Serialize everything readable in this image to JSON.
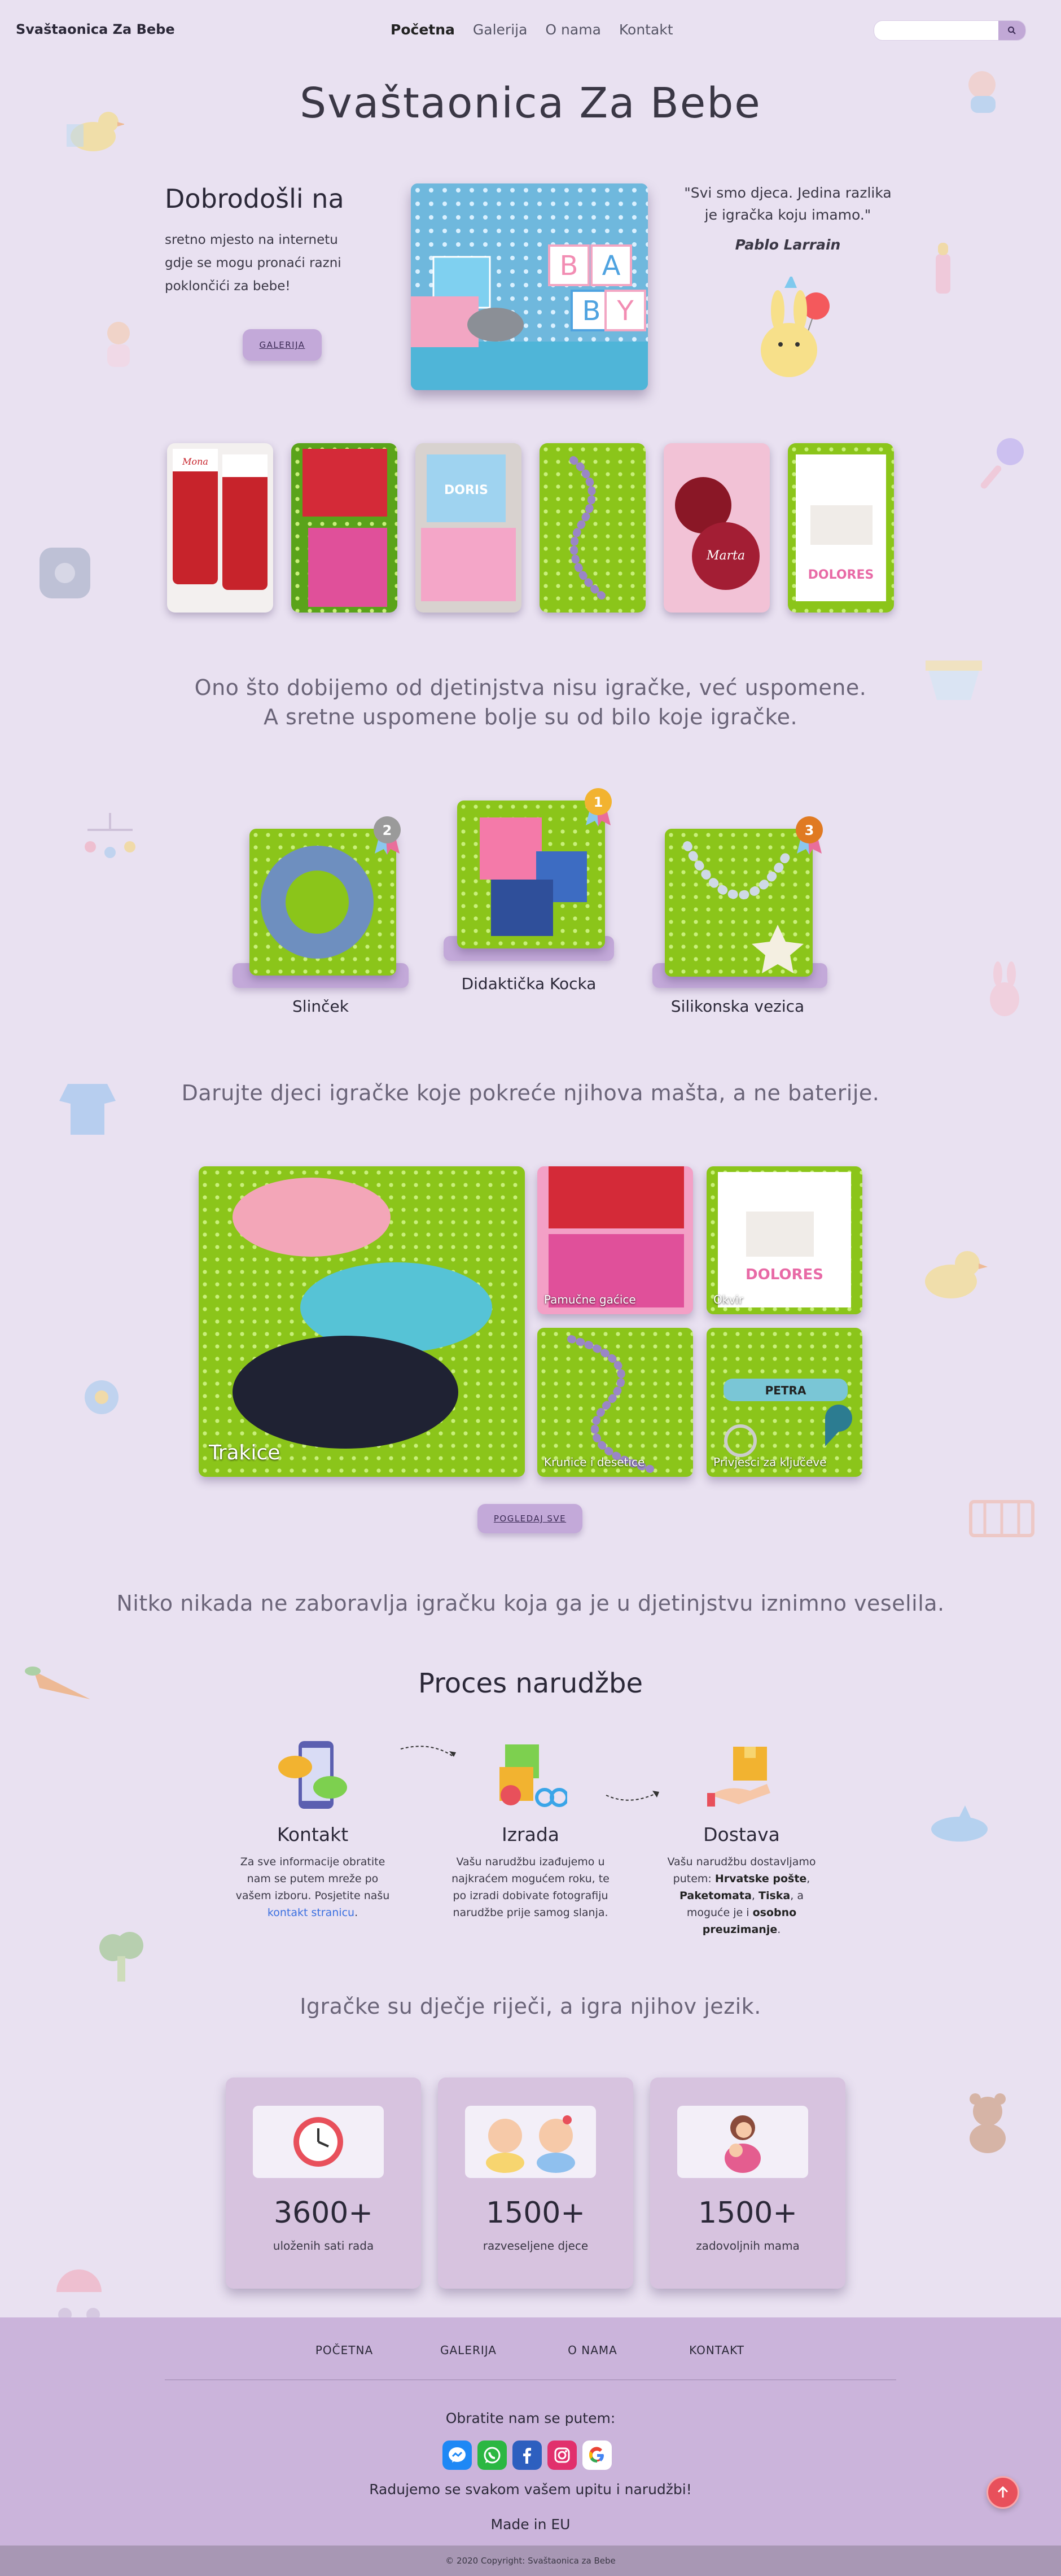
{
  "nav": {
    "brand": "Svaštaonica Za Bebe",
    "items": [
      "Početna",
      "Galerija",
      "O nama",
      "Kontakt"
    ],
    "search_placeholder": ""
  },
  "hero": {
    "title": "Svaštaonica Za Bebe",
    "welcome_title": "Dobrodošli na",
    "welcome_text": "sretno mjesto na internetu gdje se mogu pronaći razni poklončići za bebe!",
    "gallery_button": "GALERIJA",
    "quote": "\"Svi smo djeca. Jedina razlika je igračka koju imamo.\"",
    "quote_author": "Pablo Larrain",
    "hero_blocks": [
      "B",
      "A",
      "B",
      "Y"
    ]
  },
  "strip": [
    {
      "name": "Čarapice",
      "text": "Mona"
    },
    {
      "name": "Pindjame",
      "text": ""
    },
    {
      "name": "Kocke",
      "text": "DORIS"
    },
    {
      "name": "Krunica",
      "text": ""
    },
    {
      "name": "Kuglice",
      "text": "Marta"
    },
    {
      "name": "Okvir",
      "text": "DOLORES"
    }
  ],
  "taglines": {
    "t1": "Ono što dobijemo od djetinjstva nisu igračke, već uspomene. A sretne uspomene bolje su od bilo koje igračke.",
    "t2": "Darujte djeci igračke koje pokreće njihova mašta, a ne baterije.",
    "t3": "Nitko nikada ne zaboravlja igračku koja ga je u djetinjstvu iznimno veselila.",
    "t4": "Igračke su dječje riječi, a igra njihov jezik."
  },
  "products": [
    {
      "name": "Slinček",
      "rank": "2",
      "medal_color": "#9a9a9a"
    },
    {
      "name": "Didaktička Kocka",
      "rank": "1",
      "medal_color": "#f2b330"
    },
    {
      "name": "Silikonska vezica",
      "rank": "3",
      "medal_color": "#e07a22"
    }
  ],
  "mosaic": {
    "big": "Trakice",
    "tiles": [
      "Pamučne gaćice",
      "Okvir",
      "Krunice i desetice",
      "Privjesci za ključeve"
    ],
    "button": "POGLEDAJ SVE",
    "tag_name": "PETRA"
  },
  "process": {
    "title": "Proces narudžbe",
    "steps": [
      {
        "title": "Kontakt",
        "text_before": "Za sve informacije obratite nam se putem mreže po vašem izboru. Posjetite našu ",
        "link": "kontakt stranicu",
        "text_after": "."
      },
      {
        "title": "Izrada",
        "text": "Vašu narudžbu izađujemo u najkraćem mogućem roku, te po izradi dobivate fotografiju narudžbe prije samog slanja."
      },
      {
        "title": "Dostava",
        "text1": "Vašu narudžbu dostavljamo putem: ",
        "b1": "Hrvatske pošte",
        "text2": ", ",
        "b2": "Paketomata",
        "text3": ", ",
        "b3": "Tiska",
        "text4": ", a moguće je i ",
        "b4": "osobno preuzimanje",
        "text5": "."
      }
    ]
  },
  "stats": [
    {
      "value": "3600+",
      "label": "uloženih sati rada",
      "icon": "clock-icon"
    },
    {
      "value": "1500+",
      "label": "razveseljene djece",
      "icon": "babies-icon"
    },
    {
      "value": "1500+",
      "label": "zadovoljnih mama",
      "icon": "mother-icon"
    }
  ],
  "footer": {
    "menu": [
      "POČETNA",
      "GALERIJA",
      "O NAMA",
      "KONTAKT"
    ],
    "contact": "Obratite nam se putem:",
    "message": "Radujemo se svakom vašem upitu i narudžbi!",
    "made": "Made in EU",
    "copyright": "© 2020 Copyright: Svaštaonica za Bebe",
    "socials": [
      "messenger-icon",
      "whatsapp-icon",
      "facebook-icon",
      "instagram-icon",
      "google-icon"
    ]
  },
  "colors": {
    "background": "#e9e1f1",
    "accent": "#c3a9d9",
    "footer": "#cbb4db",
    "scroll_top": "#e8505b"
  }
}
